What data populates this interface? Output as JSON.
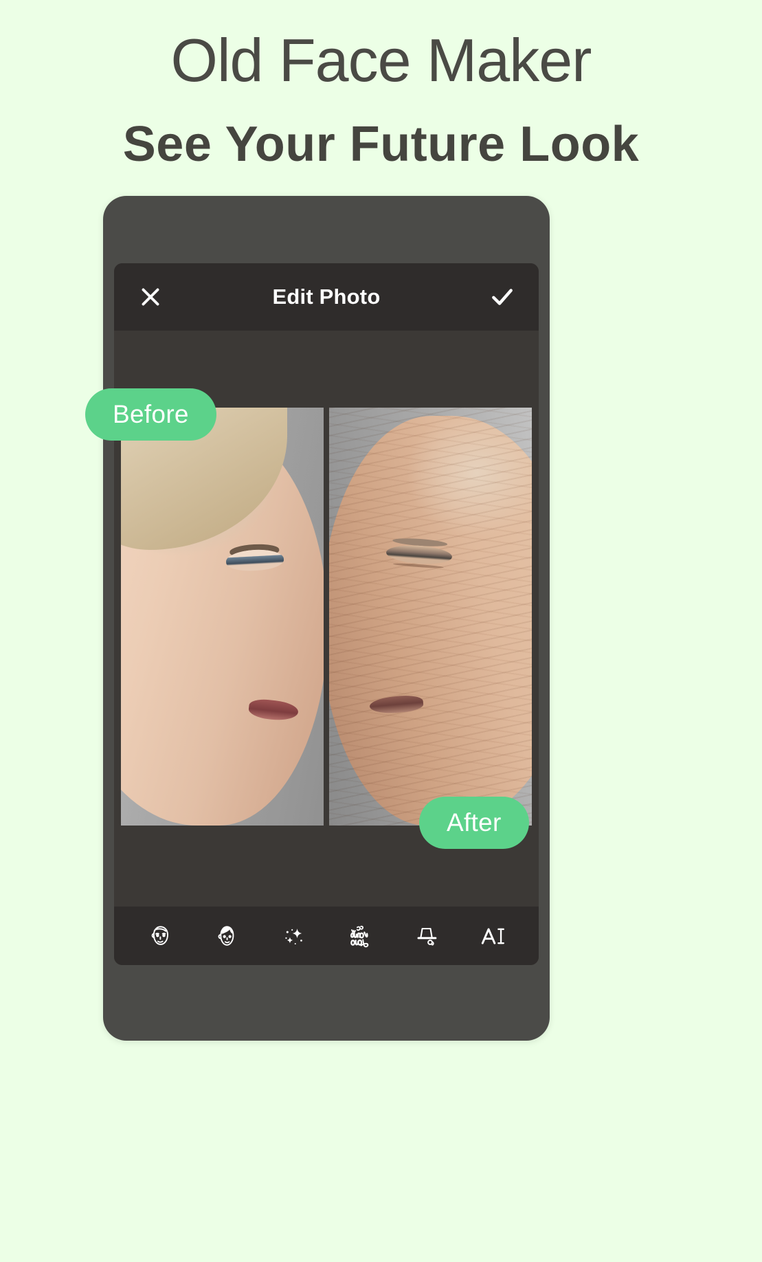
{
  "page": {
    "background_color": "#ecffe6",
    "title": "Old Face Maker",
    "subtitle": "See Your Future Look"
  },
  "phone": {
    "frame_color": "#4b4b48",
    "screen_background": "#3c3936"
  },
  "app": {
    "header": {
      "background_color": "#2f2c2b",
      "title": "Edit Photo",
      "close_icon": "close-icon",
      "confirm_icon": "check-icon"
    },
    "comparison": {
      "before_label": "Before",
      "after_label": "After",
      "badge_color": "#5cd28a",
      "panes": [
        {
          "name": "before-photo",
          "description": "young-woman-profile"
        },
        {
          "name": "after-photo",
          "description": "aged-woman-profile"
        }
      ]
    },
    "toolbar": {
      "background_color": "#2f2c2b",
      "items": [
        {
          "id": "old-face-tool",
          "icon": "old-man-face-icon",
          "label": ""
        },
        {
          "id": "hair-tool",
          "icon": "hair-face-icon",
          "label": ""
        },
        {
          "id": "effects-tool",
          "icon": "sparkles-icon",
          "label": ""
        },
        {
          "id": "sticker-tool",
          "icon": "script-sticker-icon",
          "label": ""
        },
        {
          "id": "hat-tool",
          "icon": "top-hat-monocle-icon",
          "label": ""
        },
        {
          "id": "text-tool",
          "icon": "text-a-cursor-icon",
          "label": "A"
        }
      ]
    }
  }
}
